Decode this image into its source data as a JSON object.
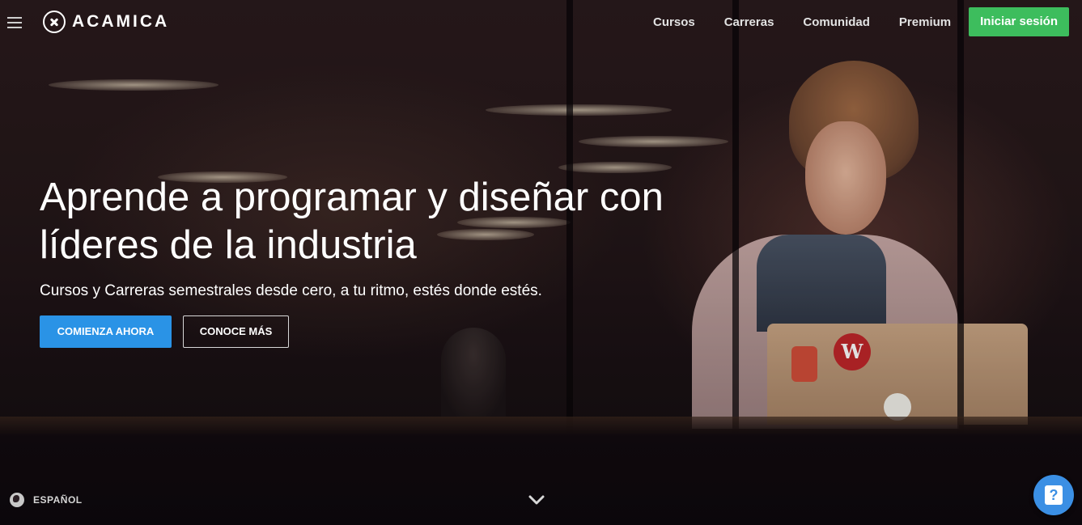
{
  "header": {
    "brand": "ACAMICA",
    "nav": [
      "Cursos",
      "Carreras",
      "Comunidad",
      "Premium"
    ],
    "login_label": "Iniciar sesión"
  },
  "hero": {
    "title": "Aprende a programar y diseñar con líderes de la industria",
    "subtitle": "Cursos y Carreras semestrales desde cero, a tu ritmo, estés donde estés.",
    "primary_cta": "COMIENZA AHORA",
    "secondary_cta": "CONOCE MÁS"
  },
  "footer": {
    "language": "ESPAÑOL",
    "help_icon_text": "?"
  },
  "colors": {
    "login_bg": "#3dbd5d",
    "primary_cta_bg": "#2a93e6",
    "help_bg": "#3b8fe4"
  },
  "icons": [
    "menu-icon",
    "acamica-logo-icon",
    "globe-icon",
    "chevron-down-icon",
    "help-icon"
  ]
}
